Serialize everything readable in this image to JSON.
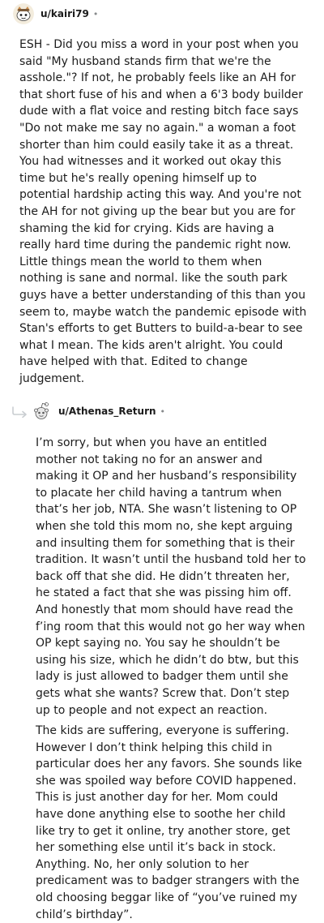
{
  "top_comment": {
    "username": "u/kairi79",
    "separator": "•",
    "avatar_icon": "snoo-avatar-icon",
    "body": "ESH - Did you miss a word in your post when you said \"My husband stands firm that we're the asshole.\"? If not, he probably feels like an AH for that short fuse of his and when a 6'3 body builder dude with a flat voice and resting bitch face says \"Do not make me say no again.\" a woman a foot shorter than him could easily take it as a threat. You had witnesses and it worked out okay this time but he's really opening himself up to potential hardship acting this way. And you're not the AH for not giving up the bear but you are for shaming the kid for crying. Kids are having a really hard time during the pandemic right now. Little things mean the world to them when nothing is sane and normal. like the south park guys have a better understanding of this than you seem to, maybe watch the pandemic episode with Stan's efforts to get Butters to build-a-bear to see what I mean. The kids aren't alright. You could have helped with that. Edited to change judgement."
  },
  "reply": {
    "username": "u/Athenas_Return",
    "separator": "•",
    "avatar_icon": "snoo-avatar-icon",
    "reply_icon": "reply-arrow-icon",
    "paragraphs": [
      "I’m sorry, but when you have an entitled mother not taking no for an answer and making it OP and her husband’s responsibility to placate her child having a tantrum when that’s her job, NTA. She wasn’t listening to OP when she told this mom no, she kept arguing and insulting them for something that is their tradition. It wasn’t until the husband told her to back off that she did. He didn’t threaten her, he stated a fact that she was pissing him off. And honestly that mom should have read the f’ing room that this would not go her way when OP kept saying no. You say he shouldn’t be using his size, which he didn’t do btw, but this lady is just allowed to badger them until she gets what she wants? Screw that. Don’t step up to people and not expect an reaction.",
      "The kids are suffering, everyone is suffering. However I don’t think helping this child in particular does her any favors. She sounds like she was spoiled way before COVID happened. This is just another day for her. Mom could have done anything else to soothe her child like try to get it online, try another store, get her something else until it’s back in stock. Anything. No, her only solution to her predicament was to badger strangers with the old choosing beggar like of “you’ve ruined my child’s birthday”."
    ]
  }
}
